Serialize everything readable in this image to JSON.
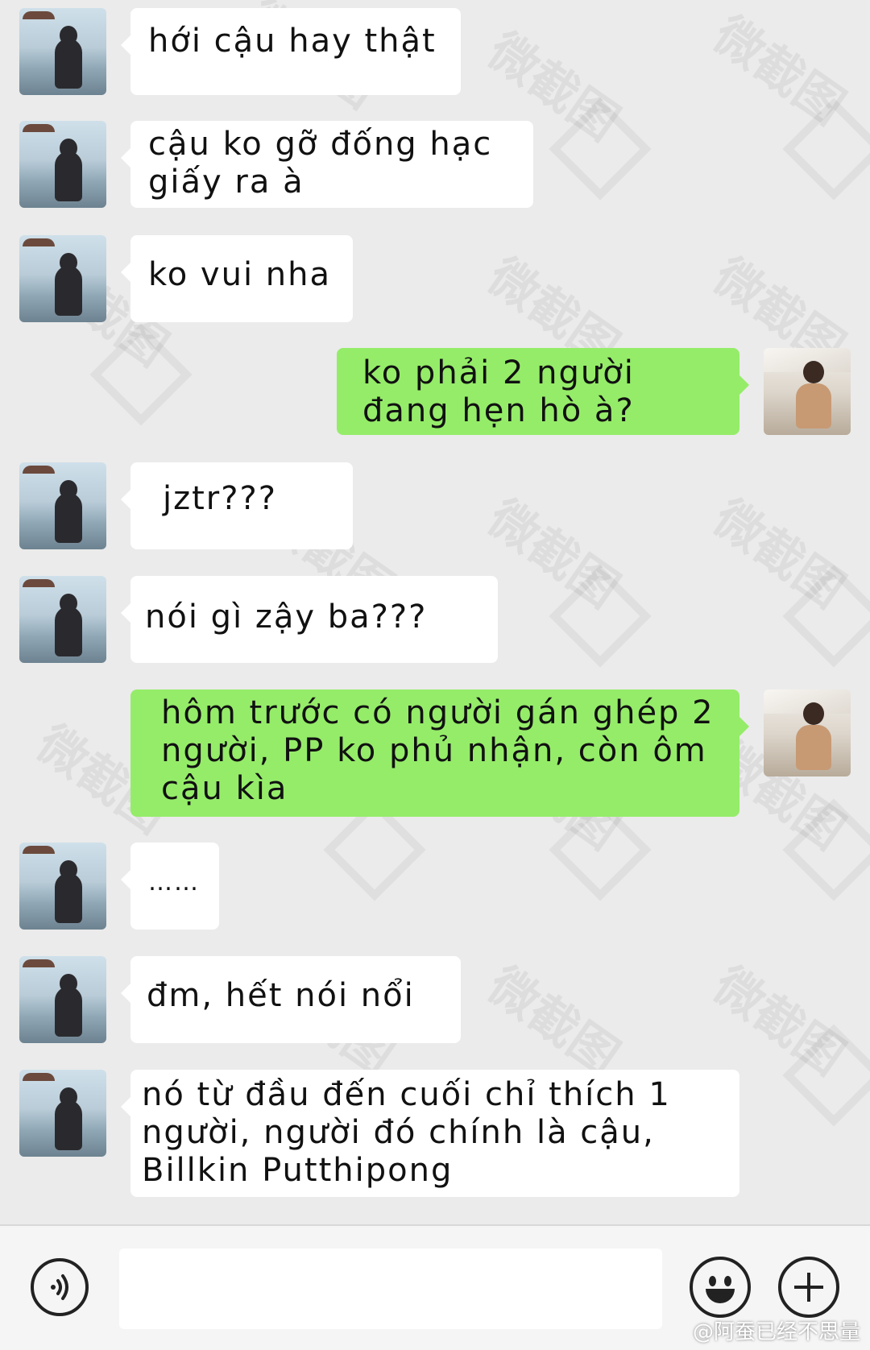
{
  "messages": [
    {
      "side": "left",
      "text": "hới cậu hay thật"
    },
    {
      "side": "left",
      "text": "cậu ko gỡ đống hạc giấy ra à"
    },
    {
      "side": "left",
      "text": "ko vui nha"
    },
    {
      "side": "right",
      "text": "ko phải 2 người đang hẹn hò à?"
    },
    {
      "side": "left",
      "text": "jztr???"
    },
    {
      "side": "left",
      "text": "nói gì zậy ba???"
    },
    {
      "side": "right",
      "text": "hôm trước có người gán ghép 2 người, PP ko phủ nhận, còn ôm cậu kìa"
    },
    {
      "side": "left",
      "text": "……"
    },
    {
      "side": "left",
      "text": "đm, hết nói nổi"
    },
    {
      "side": "left",
      "text": "nó từ đầu đến cuối chỉ thích 1 người, người đó chính là cậu, Billkin Putthipong"
    }
  ],
  "input": {
    "value": "",
    "placeholder": ""
  },
  "credit": "@阿蚕已经不思量",
  "watermark": "微截图",
  "colors": {
    "background": "#ebebeb",
    "incoming_bubble": "#ffffff",
    "outgoing_bubble": "#95ec69"
  }
}
